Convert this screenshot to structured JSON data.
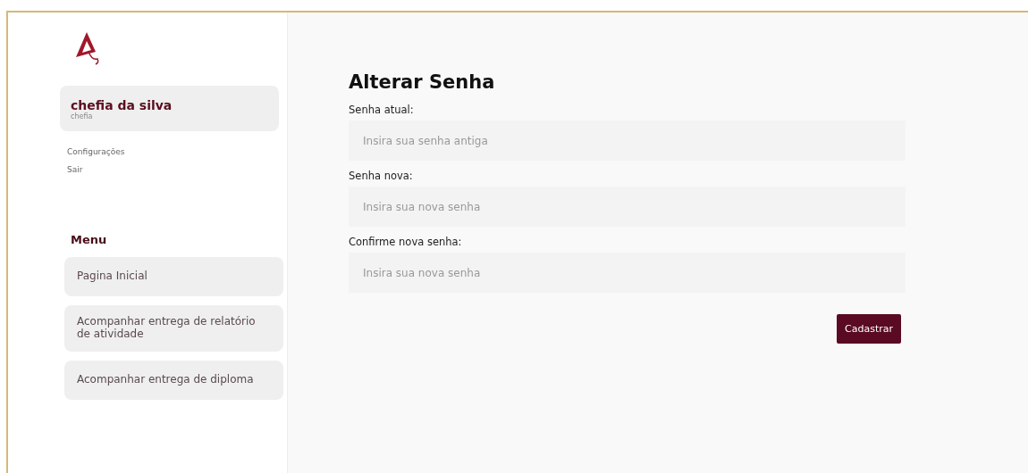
{
  "user": {
    "name": "chefia da silva",
    "role": "chefia"
  },
  "account_links": [
    "Configurações",
    "Sair"
  ],
  "menu": {
    "title": "Menu",
    "items": [
      {
        "label": "Pagina Inicial"
      },
      {
        "label": "Acompanhar entrega de relatório de atividade"
      },
      {
        "label": "Acompanhar entrega de diploma"
      }
    ]
  },
  "form": {
    "title": "Alterar Senha",
    "fields": [
      {
        "label": "Senha atual:",
        "placeholder": "Insira sua senha antiga"
      },
      {
        "label": "Senha nova:",
        "placeholder": "Insira sua nova senha"
      },
      {
        "label": "Confirme nova senha:",
        "placeholder": "Insira sua nova senha"
      }
    ],
    "submit": "Cadastrar"
  }
}
